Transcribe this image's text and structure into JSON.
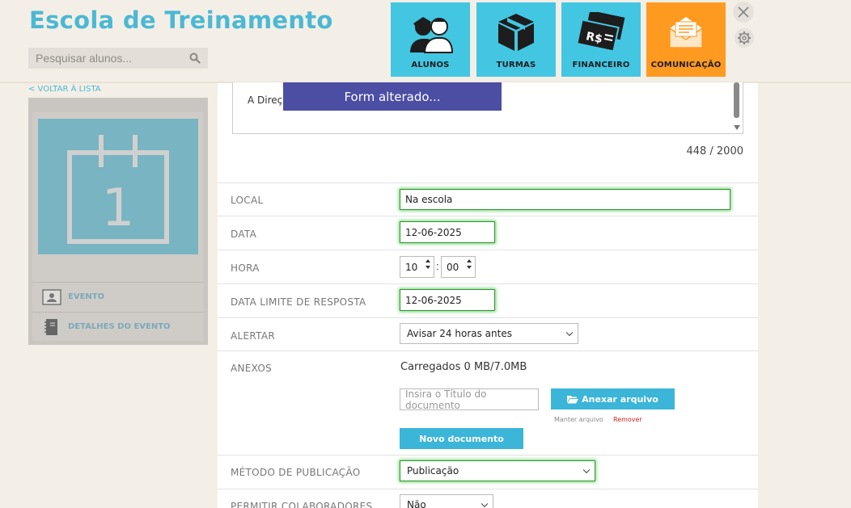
{
  "header": {
    "title": "Escola de Treinamento",
    "search_placeholder": "Pesquisar alunos..."
  },
  "nav": [
    {
      "label": "ALUNOS",
      "icon": "students-icon"
    },
    {
      "label": "TURMAS",
      "icon": "box-icon"
    },
    {
      "label": "FINANCEIRO",
      "icon": "money-icon"
    },
    {
      "label": "COMUNICAÇÃO",
      "icon": "envelope-icon",
      "active": true
    }
  ],
  "sidebar": {
    "back_label": "< VOLTAR À LISTA",
    "calendar_day": "1",
    "items": [
      {
        "label": "EVENTO",
        "icon": "contact-card-icon"
      },
      {
        "label": "DETALHES DO EVENTO",
        "icon": "notebook-icon"
      }
    ]
  },
  "message": {
    "text_visible": "A Direção",
    "toast": "Form alterado...",
    "char_count": "448 / 2000"
  },
  "form": {
    "local": {
      "label": "LOCAL",
      "value": "Na escola"
    },
    "data": {
      "label": "DATA",
      "value": "12-06-2025"
    },
    "hora": {
      "label": "HORA",
      "hours": "10",
      "minutes": "00",
      "separator": ":"
    },
    "data_limite": {
      "label": "DATA LIMITE DE RESPOSTA",
      "value": "12-06-2025"
    },
    "alertar": {
      "label": "ALERTAR",
      "value": "Avisar 24 horas antes"
    },
    "anexos": {
      "label": "ANEXOS",
      "uploaded": "Carregados 0 MB/7.0MB",
      "title_placeholder": "Insira o Título do documento",
      "attach_button": "Anexar arquivo",
      "keep_link": "Manter arquivo",
      "remove_link": "Remover",
      "new_doc_button": "Novo documento"
    },
    "metodo": {
      "label": "MÉTODO DE PUBLICAÇÃO",
      "value": "Publicação"
    },
    "colaboradores": {
      "label": "PERMITIR COLABORADORES",
      "value": "Não"
    }
  },
  "colors": {
    "brand": "#4bb8d4",
    "tile": "#43c6e2",
    "tile_active": "#ff9a20",
    "toast": "#4b4ea3",
    "remove_link": "#cc2222"
  }
}
